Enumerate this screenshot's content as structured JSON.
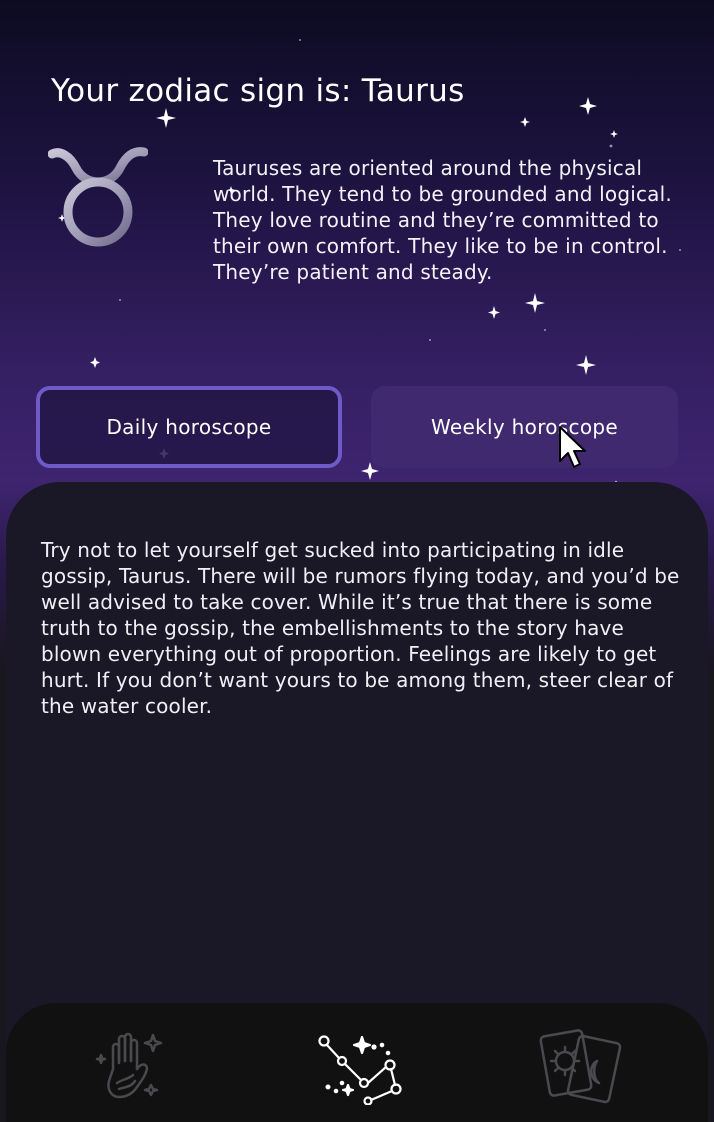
{
  "header": {
    "title": "Your zodiac sign is: Taurus"
  },
  "sign": {
    "name": "Taurus",
    "symbol_icon": "taurus-symbol-icon",
    "description": "Tauruses are oriented around the physical world. They tend to be grounded and logical. They love routine and they’re committed to their own comfort. They like to be in control. They’re patient and steady."
  },
  "tabs": {
    "daily_label": "Daily horoscope",
    "weekly_label": "Weekly horoscope",
    "selected": "daily"
  },
  "horoscope": {
    "text": "Try not to let yourself get sucked into participating in idle gossip, Taurus. There will be rumors flying today, and you’d be well advised to take cover. While it’s true that there is some truth to the gossip, the embellishments to the story have blown everything out of proportion. Feelings are likely to get hurt. If you don’t want yours to be among them, steer clear of the water cooler."
  },
  "bottom_nav": {
    "items": [
      {
        "icon": "palmistry-hand-icon",
        "active": false
      },
      {
        "icon": "constellation-icon",
        "active": true
      },
      {
        "icon": "tarot-cards-icon",
        "active": false
      }
    ]
  },
  "colors": {
    "accent": "#6e5bc7",
    "weekly_button": "#40296f",
    "card_bg": "#1a1826",
    "nav_bg": "#111111",
    "icon_inactive": "#4a4a4e",
    "icon_active": "#ffffff"
  }
}
